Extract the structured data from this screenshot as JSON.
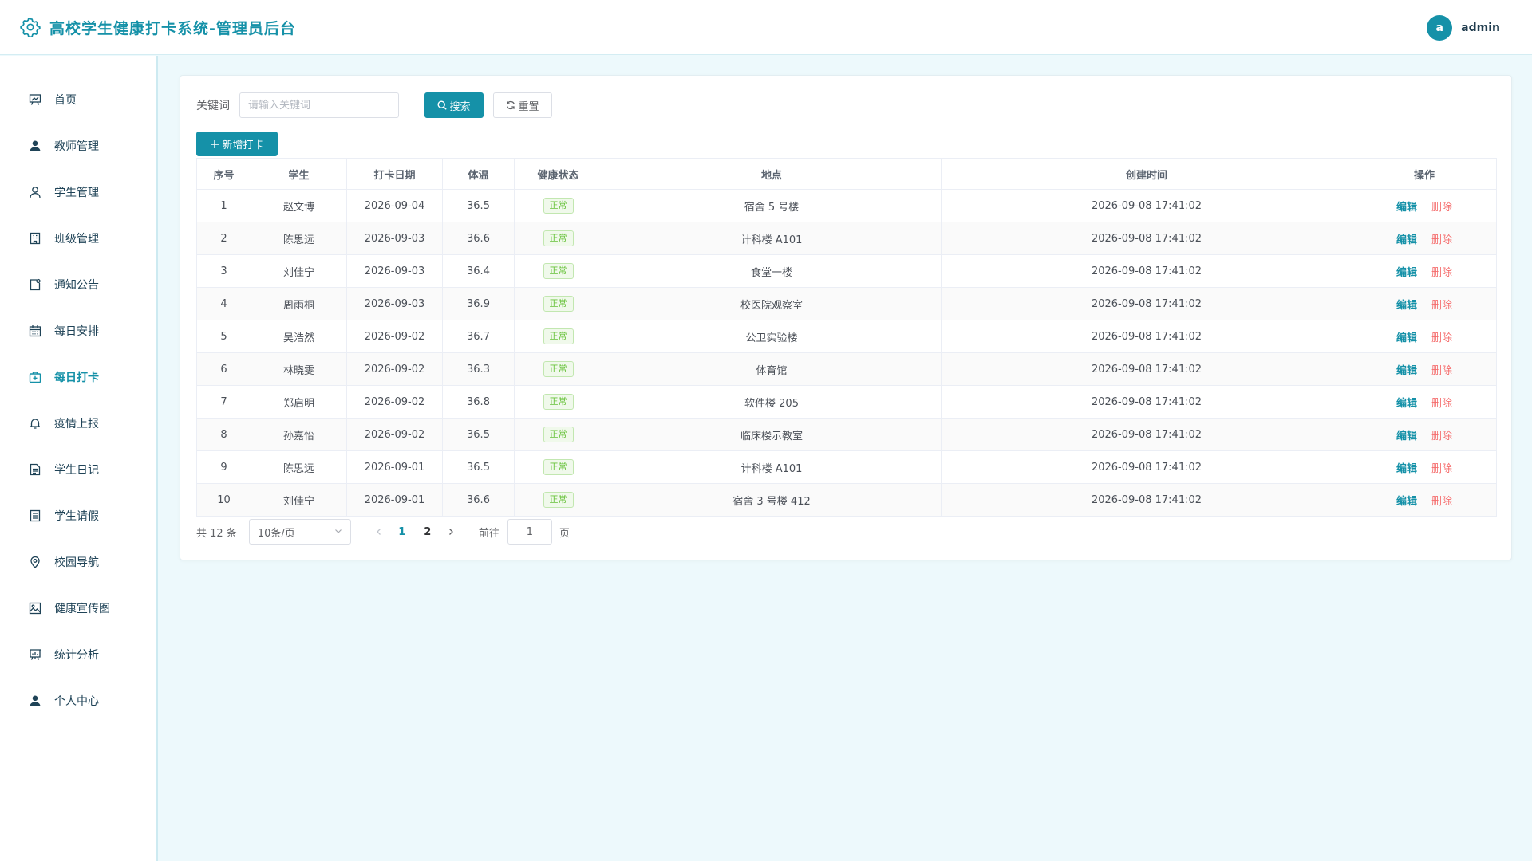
{
  "header": {
    "title": "高校学生健康打卡系统-管理员后台",
    "avatar_letter": "a",
    "username": "admin"
  },
  "colors": {
    "accent": "#1591a8",
    "danger": "#f56c6c",
    "success": "#67c23a",
    "background": "#edf9fc"
  },
  "sidebar": {
    "items": [
      {
        "label": "首页",
        "icon": "chart-board-icon"
      },
      {
        "label": "教师管理",
        "icon": "user-filled-icon"
      },
      {
        "label": "学生管理",
        "icon": "user-icon"
      },
      {
        "label": "班级管理",
        "icon": "building-icon"
      },
      {
        "label": "通知公告",
        "icon": "notice-icon"
      },
      {
        "label": "每日安排",
        "icon": "calendar-icon"
      },
      {
        "label": "每日打卡",
        "icon": "first-aid-kit-icon",
        "active": true
      },
      {
        "label": "疫情上报",
        "icon": "bell-icon"
      },
      {
        "label": "学生日记",
        "icon": "document-icon"
      },
      {
        "label": "学生请假",
        "icon": "tickets-icon"
      },
      {
        "label": "校园导航",
        "icon": "location-icon"
      },
      {
        "label": "健康宣传图",
        "icon": "picture-icon"
      },
      {
        "label": "统计分析",
        "icon": "presentation-icon"
      },
      {
        "label": "个人中心",
        "icon": "user-filled-icon"
      }
    ]
  },
  "search": {
    "label": "关键词",
    "placeholder": "请输入关键词",
    "value": "",
    "search_label": "搜索",
    "reset_label": "重置"
  },
  "add_button_label": "新增打卡",
  "table": {
    "columns": [
      "序号",
      "学生",
      "打卡日期",
      "体温",
      "健康状态",
      "地点",
      "创建时间",
      "操作"
    ],
    "edit_label": "编辑",
    "delete_label": "删除",
    "rows": [
      {
        "no": "1",
        "student": "赵文博",
        "date": "2026-09-04",
        "temp": "36.5",
        "status": "正常",
        "place": "宿舍 5 号楼",
        "created": "2026-09-08 17:41:02"
      },
      {
        "no": "2",
        "student": "陈思远",
        "date": "2026-09-03",
        "temp": "36.6",
        "status": "正常",
        "place": "计科楼 A101",
        "created": "2026-09-08 17:41:02"
      },
      {
        "no": "3",
        "student": "刘佳宁",
        "date": "2026-09-03",
        "temp": "36.4",
        "status": "正常",
        "place": "食堂一楼",
        "created": "2026-09-08 17:41:02"
      },
      {
        "no": "4",
        "student": "周雨桐",
        "date": "2026-09-03",
        "temp": "36.9",
        "status": "正常",
        "place": "校医院观察室",
        "created": "2026-09-08 17:41:02"
      },
      {
        "no": "5",
        "student": "吴浩然",
        "date": "2026-09-02",
        "temp": "36.7",
        "status": "正常",
        "place": "公卫实验楼",
        "created": "2026-09-08 17:41:02"
      },
      {
        "no": "6",
        "student": "林晓雯",
        "date": "2026-09-02",
        "temp": "36.3",
        "status": "正常",
        "place": "体育馆",
        "created": "2026-09-08 17:41:02"
      },
      {
        "no": "7",
        "student": "郑启明",
        "date": "2026-09-02",
        "temp": "36.8",
        "status": "正常",
        "place": "软件楼 205",
        "created": "2026-09-08 17:41:02"
      },
      {
        "no": "8",
        "student": "孙嘉怡",
        "date": "2026-09-02",
        "temp": "36.5",
        "status": "正常",
        "place": "临床楼示教室",
        "created": "2026-09-08 17:41:02"
      },
      {
        "no": "9",
        "student": "陈思远",
        "date": "2026-09-01",
        "temp": "36.5",
        "status": "正常",
        "place": "计科楼 A101",
        "created": "2026-09-08 17:41:02"
      },
      {
        "no": "10",
        "student": "刘佳宁",
        "date": "2026-09-01",
        "temp": "36.6",
        "status": "正常",
        "place": "宿舍 3 号楼 412",
        "created": "2026-09-08 17:41:02"
      }
    ]
  },
  "pagination": {
    "total_text": "共 12 条",
    "page_size": "10条/页",
    "pages": [
      "1",
      "2"
    ],
    "current_page": "1",
    "goto_label": "前往",
    "jump_value": "1",
    "page_suffix": "页"
  }
}
